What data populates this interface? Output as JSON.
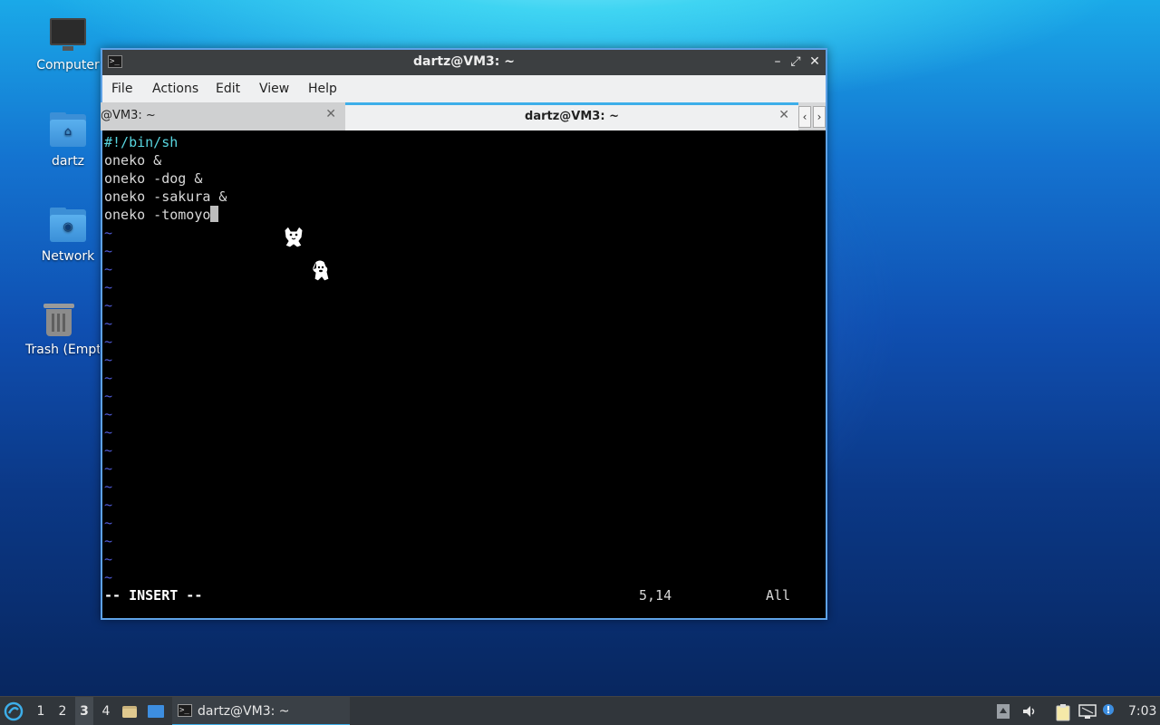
{
  "desktop": {
    "icons": [
      {
        "label": "Computer",
        "icon": "computer-icon"
      },
      {
        "label": "dartz",
        "icon": "home-folder-icon"
      },
      {
        "label": "Network",
        "icon": "network-folder-icon"
      },
      {
        "label": "Trash (Empty)",
        "icon": "trash-icon"
      }
    ]
  },
  "window": {
    "title": "dartz@VM3: ~",
    "controls": {
      "minimize": "–",
      "maximize": "⤢",
      "close": "✕"
    },
    "menu": [
      "File",
      "Actions",
      "Edit",
      "View",
      "Help"
    ],
    "tabs": [
      {
        "label": "@VM3: ~",
        "close": "✕"
      },
      {
        "label": "dartz@VM3: ~",
        "close": "✕"
      }
    ],
    "tab_scroll": {
      "left": "‹",
      "right": "›"
    }
  },
  "terminal": {
    "lines": [
      "#!/bin/sh",
      "oneko &",
      "oneko -dog &",
      "oneko -sakura &",
      "oneko -tomoyo"
    ],
    "tilde": "~",
    "mode": "-- INSERT --",
    "position": "5,14",
    "scroll": "All"
  },
  "taskbar": {
    "workspaces": [
      "1",
      "2",
      "3",
      "4"
    ],
    "current_workspace": "3",
    "task_label": "dartz@VM3: ~",
    "task_icon_text": ">_",
    "clock": "7:03"
  },
  "colors": {
    "accent": "#3daee9",
    "titlebar": "#3c3f41",
    "terminal_bg": "#000000",
    "shebang": "#58d6e0",
    "tilde": "#4f5bd8"
  }
}
